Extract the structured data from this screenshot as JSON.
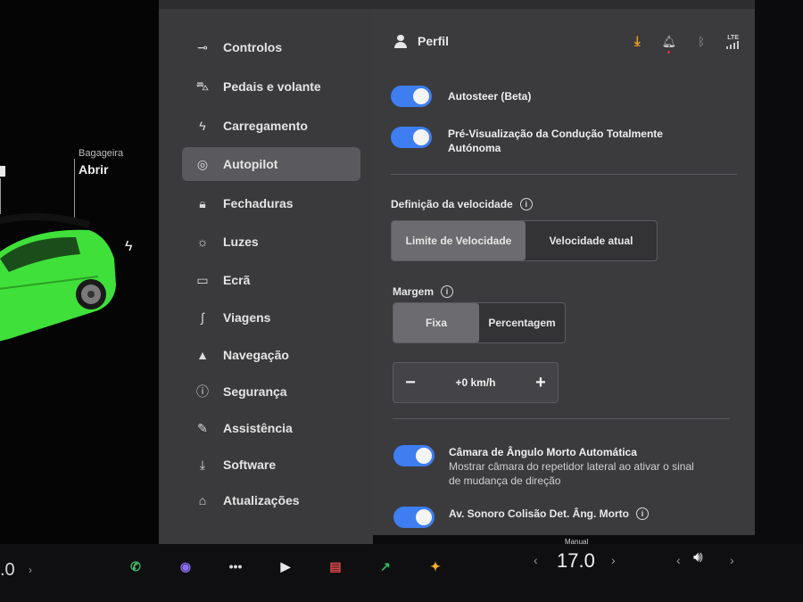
{
  "car": {
    "trunk_label": "Bagageira",
    "trunk_action": "Abrir"
  },
  "sidebar": {
    "items": [
      {
        "label": "Controlos",
        "icon": "toggle-icon",
        "glyph": "⊸",
        "active": false
      },
      {
        "label": "Pedais e volante",
        "icon": "car-icon",
        "glyph": "⛍",
        "active": false
      },
      {
        "label": "Carregamento",
        "icon": "bolt-icon",
        "glyph": "ϟ",
        "active": false
      },
      {
        "label": "Autopilot",
        "icon": "steering-wheel-icon",
        "glyph": "◎",
        "active": true
      },
      {
        "label": "Fechaduras",
        "icon": "lock-icon",
        "glyph": "🔒︎",
        "active": false
      },
      {
        "label": "Luzes",
        "icon": "light-icon",
        "glyph": "☼",
        "active": false
      },
      {
        "label": "Ecrã",
        "icon": "display-icon",
        "glyph": "▭",
        "active": false
      },
      {
        "label": "Viagens",
        "icon": "trips-icon",
        "glyph": "∫",
        "active": false
      },
      {
        "label": "Navegação",
        "icon": "navigation-icon",
        "glyph": "▲",
        "active": false
      },
      {
        "label": "Segurança",
        "icon": "safety-icon",
        "glyph": "ⓘ",
        "active": false
      },
      {
        "label": "Assistência",
        "icon": "wrench-icon",
        "glyph": "✎",
        "active": false
      },
      {
        "label": "Software",
        "icon": "download-icon",
        "glyph": "⤓",
        "active": false
      },
      {
        "label": "Atualizações",
        "icon": "update-lock-icon",
        "glyph": "⌂",
        "active": false
      }
    ]
  },
  "header": {
    "profile_label": "Perfil",
    "lte_label": "LTE"
  },
  "settings": {
    "autosteer": {
      "title": "Autosteer (Beta)",
      "on": true
    },
    "fsd_preview": {
      "title": "Pré-Visualização da Condução Totalmente Autónoma",
      "on": true
    },
    "speed_definition": {
      "label": "Definição da velocidade",
      "options": [
        "Limite de Velocidade",
        "Velocidade atual"
      ],
      "selected": "Limite de Velocidade"
    },
    "margin": {
      "label": "Margem",
      "options": [
        "Fixa",
        "Percentagem"
      ],
      "selected": "Fixa"
    },
    "offset": {
      "minus": "−",
      "value": "+0 km/h",
      "plus": "+"
    },
    "blindspot_camera": {
      "title": "Câmara de Ângulo Morto Automática",
      "desc": "Mostrar câmara do repetidor lateral ao ativar o sinal de mudança de direção",
      "on": true
    },
    "collision_chime": {
      "title": "Av. Sonoro Colisão Det. Âng. Morto",
      "on": true
    }
  },
  "taskbar": {
    "left_temp": ".0",
    "climate_mode": "Manual",
    "temperature": "17.0",
    "apps": [
      {
        "name": "phone-app",
        "glyph": "✆",
        "color": "#3ec46d"
      },
      {
        "name": "camera-app",
        "glyph": "◉",
        "color": "#8a6cf0"
      },
      {
        "name": "more-apps",
        "glyph": "•••",
        "color": "#d8d8d8"
      },
      {
        "name": "theater-app",
        "glyph": "▶",
        "color": "#e8e8e8"
      },
      {
        "name": "calendar-app",
        "glyph": "▤",
        "color": "#e04848"
      },
      {
        "name": "energy-app",
        "glyph": "↗",
        "color": "#2fb857"
      },
      {
        "name": "toybox-app",
        "glyph": "✦",
        "color": "#f0b030"
      }
    ]
  },
  "colors": {
    "accent_blue": "#3e7ef0",
    "download_orange": "#f0a020",
    "car_green": "#3fe03a"
  }
}
